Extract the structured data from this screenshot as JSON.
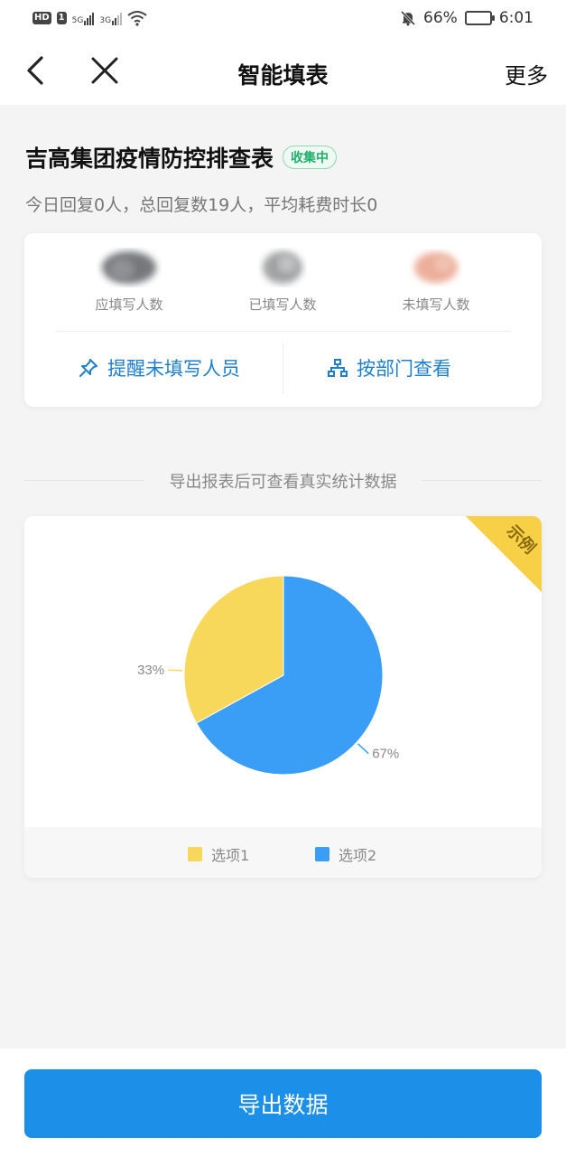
{
  "status_bar": {
    "hd": "HD",
    "sim1": "1",
    "net1": "5G",
    "net2": "3G",
    "battery_pct": "66%",
    "time": "6:01"
  },
  "nav": {
    "title": "智能填表",
    "more_label": "更多",
    "back_icon": "chevron-left-icon",
    "close_icon": "close-icon"
  },
  "form": {
    "title": "吉高集团疫情防控排查表",
    "status": "收集中",
    "summary": "今日回复0人，总回复数19人，平均耗费时长0"
  },
  "stats": [
    {
      "label": "应填写人数",
      "blur_color": "#5e6266"
    },
    {
      "label": "已填写人数",
      "blur_color": "#8a8c8e"
    },
    {
      "label": "未填写人数",
      "blur_color": "#e8a18a"
    }
  ],
  "actions": {
    "remind_label": "提醒未填写人员",
    "dept_label": "按部门查看"
  },
  "separator_text": "导出报表后可查看真实统计数据",
  "sample_ribbon": "示例",
  "chart_data": {
    "type": "pie",
    "series": [
      {
        "name": "选项1",
        "value": 33,
        "label": "33%",
        "color": "#f8d85a"
      },
      {
        "name": "选项2",
        "value": 67,
        "label": "67%",
        "color": "#3a9ef6"
      }
    ],
    "legend_position": "bottom"
  },
  "export_label": "导出数据",
  "colors": {
    "accent": "#1c8fe8",
    "status_green": "#20b06a"
  }
}
